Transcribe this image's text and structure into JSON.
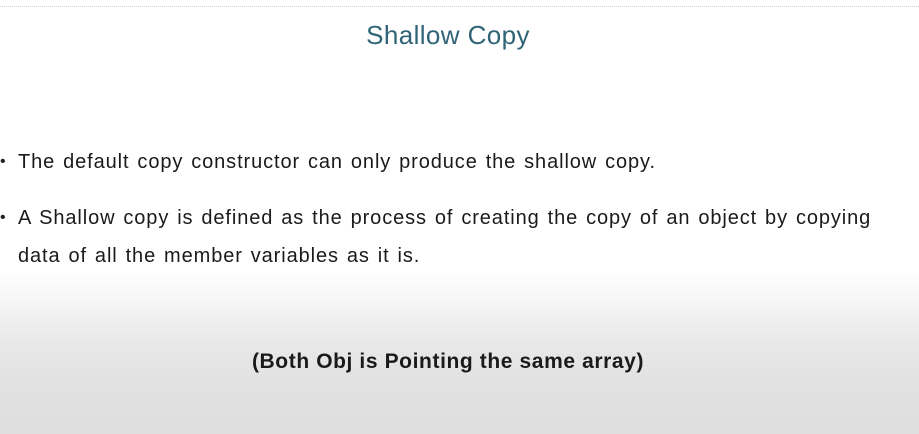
{
  "slide": {
    "title": "Shallow Copy",
    "bullets": [
      {
        "marker": "•",
        "text": "The default copy constructor can only produce the shallow copy."
      },
      {
        "marker": "•",
        "text": "A Shallow copy is defined as the process of creating the copy of an object by copying data of all the member variables as it is."
      }
    ],
    "caption": "(Both Obj is Pointing the same array)"
  },
  "colors": {
    "title": "#2f6477",
    "body_text": "#1a1a1a"
  }
}
